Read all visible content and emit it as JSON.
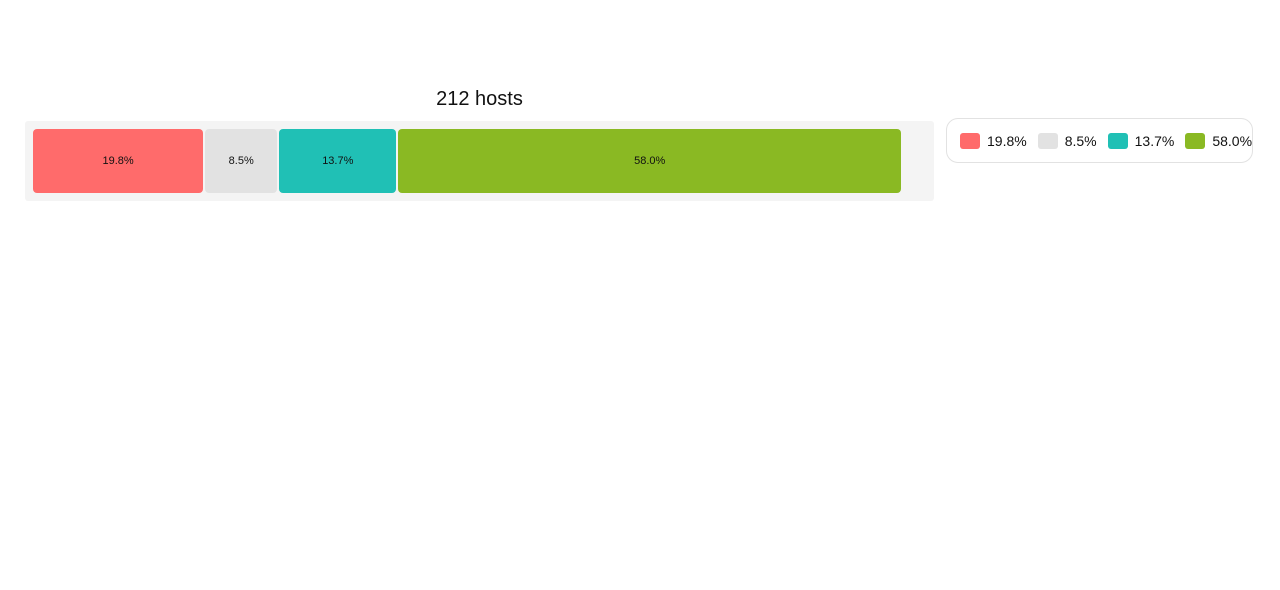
{
  "chart_data": {
    "type": "bar",
    "orientation": "horizontal-stacked",
    "title": "212 hosts",
    "series": [
      {
        "label": "19.8%",
        "value": 19.8,
        "color": "#ff6b6b"
      },
      {
        "label": "8.5%",
        "value": 8.5,
        "color": "#e2e2e2"
      },
      {
        "label": "13.7%",
        "value": 13.7,
        "color": "#20c0b5"
      },
      {
        "label": "58.0%",
        "value": 58.0,
        "color": "#8ab923"
      }
    ],
    "xlim": [
      0,
      100
    ],
    "legend_position": "right",
    "grid": false
  }
}
